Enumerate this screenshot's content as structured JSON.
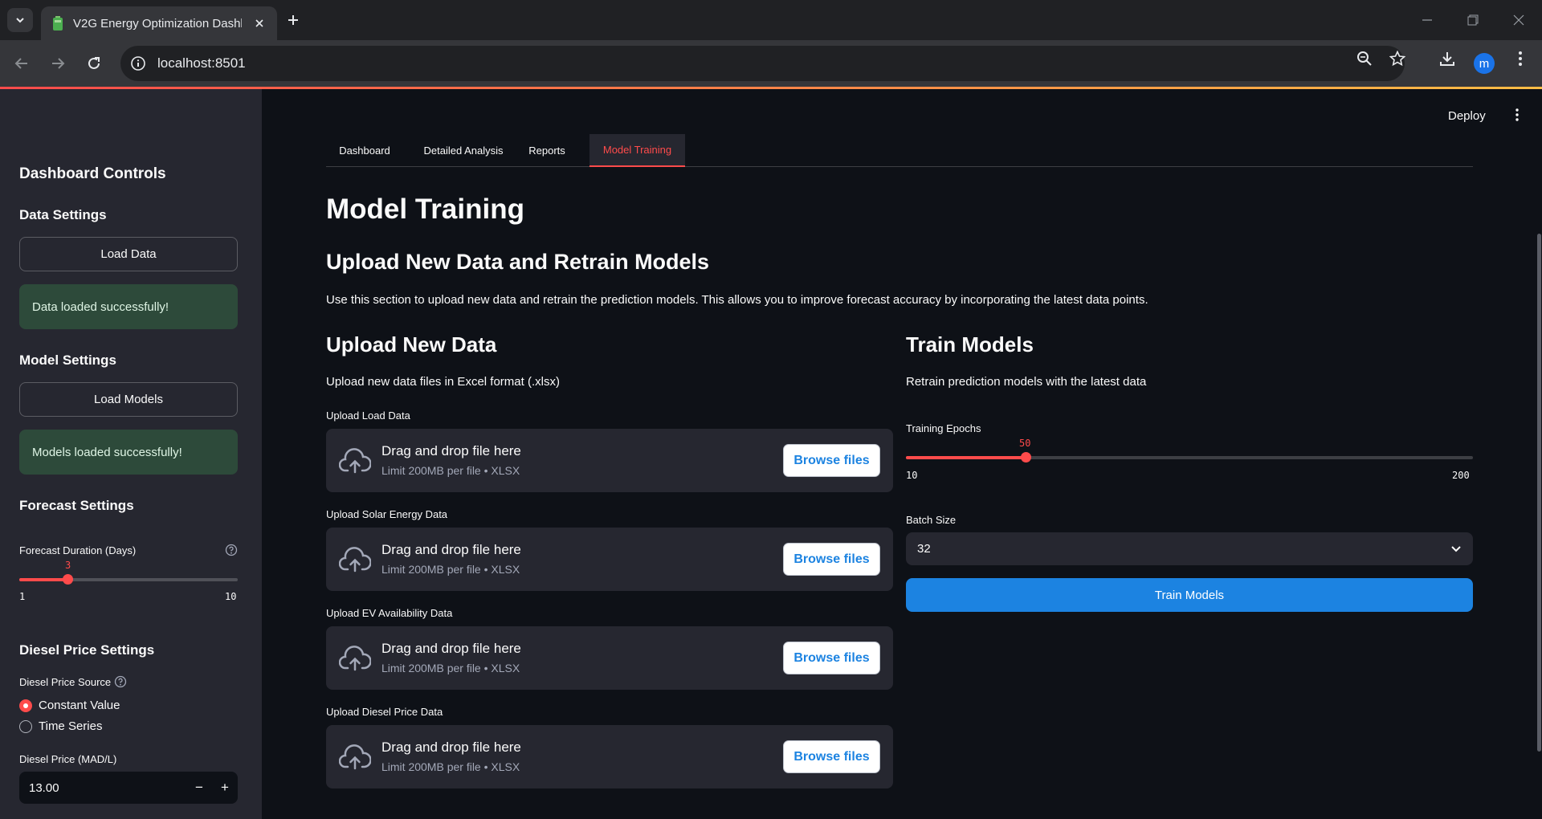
{
  "browser": {
    "tab_title": "V2G Energy Optimization Dashb",
    "url": "localhost:8501",
    "profile_initial": "m"
  },
  "colors": {
    "accent": "#ff4b4b",
    "primary_button": "#1c83e1",
    "success_bg": "#2d4a3a"
  },
  "sidebar": {
    "title": "Dashboard Controls",
    "data_settings": {
      "heading": "Data Settings",
      "button": "Load Data",
      "status": "Data loaded successfully!"
    },
    "model_settings": {
      "heading": "Model Settings",
      "button": "Load Models",
      "status": "Models loaded successfully!"
    },
    "forecast_settings": {
      "heading": "Forecast Settings",
      "label": "Forecast Duration (Days)",
      "value": "3",
      "min": "1",
      "max": "10"
    },
    "diesel_settings": {
      "heading": "Diesel Price Settings",
      "source_label": "Diesel Price Source",
      "options": [
        "Constant Value",
        "Time Series"
      ],
      "selected": "Constant Value",
      "price_label": "Diesel Price (MAD/L)",
      "price_value": "13.00"
    }
  },
  "header": {
    "deploy": "Deploy"
  },
  "tabs": [
    "Dashboard",
    "Detailed Analysis",
    "Reports",
    "Model Training"
  ],
  "active_tab": "Model Training",
  "main": {
    "title": "Model Training",
    "subtitle": "Upload New Data and Retrain Models",
    "description": "Use this section to upload new data and retrain the prediction models. This allows you to improve forecast accuracy by incorporating the latest data points.",
    "upload": {
      "heading": "Upload New Data",
      "intro": "Upload new data files in Excel format (.xlsx)",
      "drop_title": "Drag and drop file here",
      "drop_sub": "Limit 200MB per file • XLSX",
      "browse": "Browse files",
      "fields": [
        "Upload Load Data",
        "Upload Solar Energy Data",
        "Upload EV Availability Data",
        "Upload Diesel Price Data"
      ]
    },
    "train": {
      "heading": "Train Models",
      "intro": "Retrain prediction models with the latest data",
      "epochs_label": "Training Epochs",
      "epochs_value": "50",
      "epochs_min": "10",
      "epochs_max": "200",
      "batch_label": "Batch Size",
      "batch_value": "32",
      "button": "Train Models"
    }
  }
}
